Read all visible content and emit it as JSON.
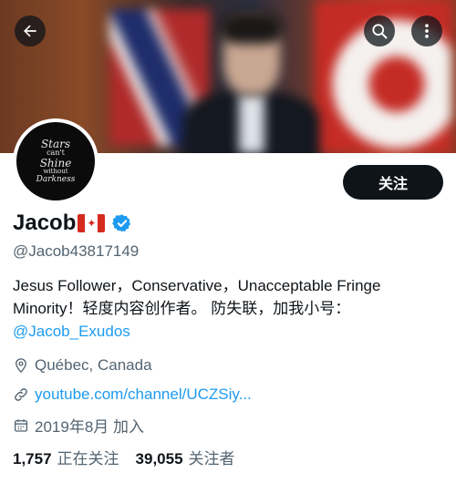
{
  "header": {
    "back_icon": "arrow-left-icon",
    "search_icon": "search-icon",
    "more_icon": "more-vertical-icon"
  },
  "avatar": {
    "lines": [
      "Stars",
      "can't",
      "Shine",
      "without",
      "Darkness"
    ]
  },
  "follow_button": {
    "label": "关注"
  },
  "profile": {
    "display_name": "Jacob",
    "name_flag": "canada-flag-emoji",
    "verified_icon": "verified-badge-icon",
    "verified_color": "#1d9bf0",
    "handle": "@Jacob43817149",
    "bio": {
      "line1": "Jesus Follower，Conservative，Unacceptable Fringe",
      "line2": "Minority！轻度内容创作者。 防失联，加我小号：",
      "mention": "@Jacob_Exudos"
    },
    "location": "Québec, Canada",
    "website": "youtube.com/channel/UCZSiy...",
    "joined": "2019年8月 加入"
  },
  "stats": {
    "following_count": "1,757",
    "following_label": "正在关注",
    "followers_count": "39,055",
    "followers_label": "关注者"
  },
  "colors": {
    "accent": "#1d9bf0",
    "text_primary": "#0f1419",
    "text_secondary": "#536471",
    "button_bg": "#0f1419"
  }
}
